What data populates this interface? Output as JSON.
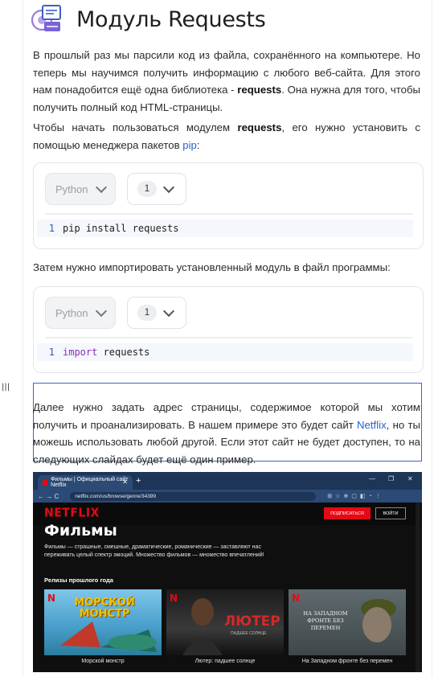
{
  "header": {
    "title": "Модуль Requests",
    "logo_icon": "computer-screen-gear-icon"
  },
  "paragraphs": {
    "p1": {
      "before": "В прошлый раз мы парсили код из файла, сохранённого на компьютере. Но теперь мы научимся получить информацию с любого веб-сайта. Для этого нам понадобится ещё одна библиотека - ",
      "bold": "requests",
      "after": ". Она нужна для того, чтобы получить полный код HTML-страницы."
    },
    "p2": {
      "before": "Чтобы начать пользоваться модулем ",
      "bold": "requests",
      "middle": ", его нужно установить с помощью менеджера пакетов ",
      "link": "pip",
      "after": ":"
    },
    "p3": "Затем нужно импортировать установленный модуль в файл программы:",
    "p4": {
      "before": "Далее нужно задать адрес страницы, содержимое которой мы хотим получить и проанализировать. В нашем примере это будет сайт ",
      "link": "Netflix",
      "after": ", но ты можешь использовать любой другой. Если этот сайт не будет доступен, то на следующих слайдах будет ещё один пример."
    }
  },
  "code_blocks": [
    {
      "language": "Python",
      "version": "1",
      "line_number": "1",
      "code": "pip install requests"
    },
    {
      "language": "Python",
      "version": "1",
      "line_number": "1",
      "keyword": "import",
      "code_rest": " requests"
    }
  ],
  "drag_handle": "|||",
  "screenshot": {
    "tab_title": "Фильмы | Официальный сайт Netflix",
    "url": "netflix.com/us/browse/genre/34399",
    "logo": "NETFLIX",
    "subscribe_label": "ПОДПИСАТЬСЯ",
    "login_label": "ВОЙТИ",
    "heading": "Фильмы",
    "description": "Фильмы — страшные, смешные, драматические, романические — заставляют нас переживать целый спектр эмоций. Множество фильмов — множество впечатлений!",
    "section_title": "Релизы прошлого года",
    "cards": [
      {
        "poster_text": "МОРСКОЙ МОНСТР",
        "caption": "Морской монстр"
      },
      {
        "poster_text": "ЛЮТЕР",
        "poster_sub": "ПАДШЕЕ СОЛНЦЕ",
        "caption": "Лютер: падшее солнце"
      },
      {
        "poster_text": "НА ЗАПАДНОМ ФРОНТЕ БЕЗ ПЕРЕМЕН",
        "caption": "На Западном фронте без перемен"
      }
    ],
    "brand_color": "#e50914"
  }
}
